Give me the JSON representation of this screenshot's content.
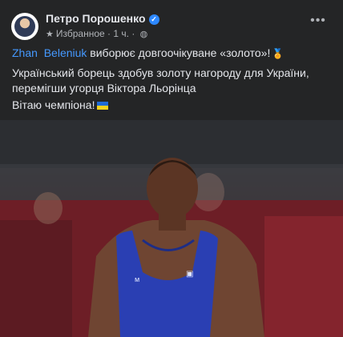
{
  "post": {
    "author": "Петро Порошенко",
    "verified_icon": "verified-badge-icon",
    "audience": "Избранное",
    "time": "1 ч.",
    "more_icon": "more-options-icon",
    "text_line1_mention1": "Zhan",
    "text_line1_mention2": "Beleniuk",
    "text_line1_rest": " виборює довгоочікуване «золото»!",
    "text_line2": "Український борець здобув золоту нагороду для України, перемігши угорця Віктора Льорінца",
    "text_line3": "Вітаю чемпіона!",
    "medal_icon": "medal-icon",
    "flag_icon": "ukraine-flag-icon"
  },
  "colors": {
    "background": "#242526",
    "text": "#e4e6eb",
    "secondary": "#b0b3b8",
    "mention": "#4599ff",
    "verified": "#2d88ff"
  }
}
